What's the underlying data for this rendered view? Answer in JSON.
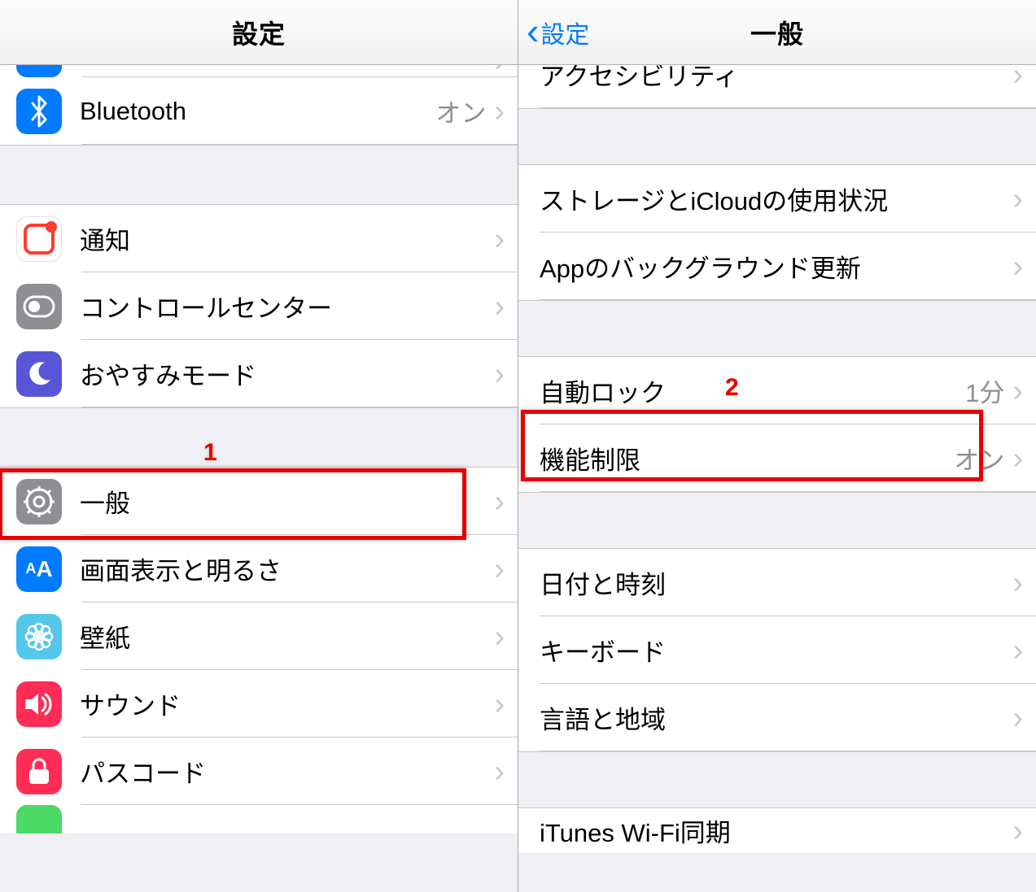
{
  "left": {
    "title": "設定",
    "rows": [
      {
        "id": "partial",
        "label": "",
        "value": "",
        "show_chevron": false
      },
      {
        "id": "bluetooth",
        "label": "Bluetooth",
        "value": "オン",
        "icon_bg": "#007aff",
        "icon": "bluetooth"
      },
      {
        "gap": true
      },
      {
        "id": "notifications",
        "label": "通知",
        "value": "",
        "icon_bg": "#ff3b30",
        "icon": "notifications"
      },
      {
        "id": "control-center",
        "label": "コントロールセンター",
        "value": "",
        "icon_bg": "#8e8e93",
        "icon": "control"
      },
      {
        "id": "dnd",
        "label": "おやすみモード",
        "value": "",
        "icon_bg": "#5856d6",
        "icon": "moon"
      },
      {
        "gap": true
      },
      {
        "id": "general",
        "label": "一般",
        "value": "",
        "icon_bg": "#8e8e93",
        "icon": "gear"
      },
      {
        "id": "display",
        "label": "画面表示と明るさ",
        "value": "",
        "icon_bg": "#007aff",
        "icon": "aa"
      },
      {
        "id": "wallpaper",
        "label": "壁紙",
        "value": "",
        "icon_bg": "#54c7eb",
        "icon": "flower"
      },
      {
        "id": "sound",
        "label": "サウンド",
        "value": "",
        "icon_bg": "#ff2d55",
        "icon": "sound"
      },
      {
        "id": "passcode",
        "label": "パスコード",
        "value": "",
        "icon_bg": "#ff2d55",
        "icon": "lock"
      },
      {
        "id": "partial2",
        "label": "",
        "value": "",
        "icon_bg": "#4cd964",
        "icon": ""
      }
    ]
  },
  "right": {
    "back_label": "設定",
    "title": "一般",
    "rows": [
      {
        "id": "accessibility",
        "label": "アクセシビリティ",
        "value": ""
      },
      {
        "gap": true
      },
      {
        "id": "storage",
        "label": "ストレージとiCloudの使用状況",
        "value": ""
      },
      {
        "id": "bg-refresh",
        "label": "Appのバックグラウンド更新",
        "value": ""
      },
      {
        "gap": true
      },
      {
        "id": "autolock",
        "label": "自動ロック",
        "value": "1分"
      },
      {
        "id": "restrictions",
        "label": "機能制限",
        "value": "オン"
      },
      {
        "gap": true
      },
      {
        "id": "datetime",
        "label": "日付と時刻",
        "value": ""
      },
      {
        "id": "keyboard",
        "label": "キーボード",
        "value": ""
      },
      {
        "id": "language",
        "label": "言語と地域",
        "value": ""
      },
      {
        "gap": true
      },
      {
        "id": "itunes-wifi",
        "label": "iTunes Wi-Fi同期",
        "value": ""
      }
    ]
  },
  "annotations": {
    "label1": "1",
    "label2": "2"
  }
}
